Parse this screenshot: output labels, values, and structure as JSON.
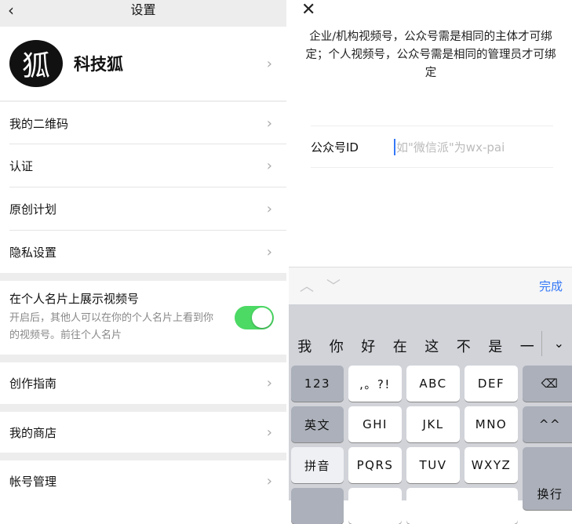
{
  "left": {
    "nav": {
      "back": "‹",
      "title": "设置"
    },
    "profile": {
      "avatar_glyph": "狐",
      "name": "科技狐"
    },
    "items": [
      {
        "label": "我的二维码"
      },
      {
        "label": "认证"
      },
      {
        "label": "原创计划"
      },
      {
        "label": "隐私设置"
      }
    ],
    "card_toggle": {
      "title": "在个人名片上展示视频号",
      "desc": "开启后，其他人可以在你的个人名片上看到你的视频号。前往个人名片",
      "on": true
    },
    "guide": "创作指南",
    "shop": "我的商店",
    "account": "帐号管理",
    "chevron": "›"
  },
  "right": {
    "close": "✕",
    "hint": "企业/机构视频号，公众号需是相同的主体才可绑定；个人视频号，公众号需是相同的管理员才可绑定",
    "field": {
      "label": "公众号ID",
      "placeholder": "如\"微信派\"为wx-pai",
      "value": ""
    },
    "toolbar": {
      "up": "︿",
      "down": "﹀",
      "done": "完成"
    },
    "candidates": [
      "我",
      "你",
      "好",
      "在",
      "这",
      "不",
      "是",
      "一"
    ],
    "expand": "⌄",
    "keys": {
      "r1": [
        "123",
        ",。?!",
        "ABC",
        "DEF",
        "⌫"
      ],
      "r2": [
        "英文",
        "GHI",
        "JKL",
        "MNO",
        "^^"
      ],
      "r3": [
        "拼音",
        "PQRS",
        "TUV",
        "WXYZ",
        "换行"
      ]
    }
  }
}
